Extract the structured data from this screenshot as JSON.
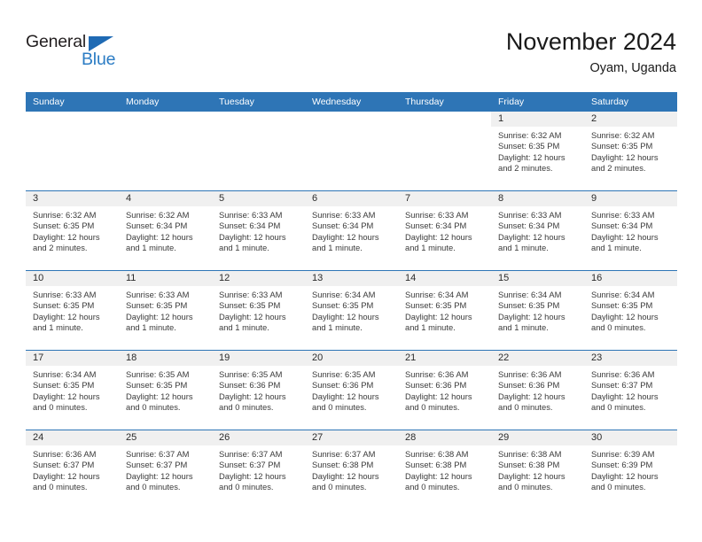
{
  "brand": {
    "name_part1": "General",
    "name_part2": "Blue",
    "triangle_color": "#1f6ab4",
    "blue_color": "#2b7cc4"
  },
  "header": {
    "title": "November 2024",
    "subtitle": "Oyam, Uganda"
  },
  "theme": {
    "header_blue": "#2e75b6",
    "daynum_band": "#f0f0f0",
    "text": "#3a3a3a"
  },
  "weekdays": [
    "Sunday",
    "Monday",
    "Tuesday",
    "Wednesday",
    "Thursday",
    "Friday",
    "Saturday"
  ],
  "weeks": [
    [
      {
        "day": "",
        "state": "blank",
        "sunrise": "",
        "sunset": "",
        "daylight1": "",
        "daylight2": ""
      },
      {
        "day": "",
        "state": "blank",
        "sunrise": "",
        "sunset": "",
        "daylight1": "",
        "daylight2": ""
      },
      {
        "day": "",
        "state": "blank",
        "sunrise": "",
        "sunset": "",
        "daylight1": "",
        "daylight2": ""
      },
      {
        "day": "",
        "state": "blank",
        "sunrise": "",
        "sunset": "",
        "daylight1": "",
        "daylight2": ""
      },
      {
        "day": "",
        "state": "blank",
        "sunrise": "",
        "sunset": "",
        "daylight1": "",
        "daylight2": ""
      },
      {
        "day": "1",
        "state": "filled",
        "sunrise": "Sunrise: 6:32 AM",
        "sunset": "Sunset: 6:35 PM",
        "daylight1": "Daylight: 12 hours",
        "daylight2": "and 2 minutes."
      },
      {
        "day": "2",
        "state": "filled",
        "sunrise": "Sunrise: 6:32 AM",
        "sunset": "Sunset: 6:35 PM",
        "daylight1": "Daylight: 12 hours",
        "daylight2": "and 2 minutes."
      }
    ],
    [
      {
        "day": "3",
        "state": "filled",
        "sunrise": "Sunrise: 6:32 AM",
        "sunset": "Sunset: 6:35 PM",
        "daylight1": "Daylight: 12 hours",
        "daylight2": "and 2 minutes."
      },
      {
        "day": "4",
        "state": "filled",
        "sunrise": "Sunrise: 6:32 AM",
        "sunset": "Sunset: 6:34 PM",
        "daylight1": "Daylight: 12 hours",
        "daylight2": "and 1 minute."
      },
      {
        "day": "5",
        "state": "filled",
        "sunrise": "Sunrise: 6:33 AM",
        "sunset": "Sunset: 6:34 PM",
        "daylight1": "Daylight: 12 hours",
        "daylight2": "and 1 minute."
      },
      {
        "day": "6",
        "state": "filled",
        "sunrise": "Sunrise: 6:33 AM",
        "sunset": "Sunset: 6:34 PM",
        "daylight1": "Daylight: 12 hours",
        "daylight2": "and 1 minute."
      },
      {
        "day": "7",
        "state": "filled",
        "sunrise": "Sunrise: 6:33 AM",
        "sunset": "Sunset: 6:34 PM",
        "daylight1": "Daylight: 12 hours",
        "daylight2": "and 1 minute."
      },
      {
        "day": "8",
        "state": "filled",
        "sunrise": "Sunrise: 6:33 AM",
        "sunset": "Sunset: 6:34 PM",
        "daylight1": "Daylight: 12 hours",
        "daylight2": "and 1 minute."
      },
      {
        "day": "9",
        "state": "filled",
        "sunrise": "Sunrise: 6:33 AM",
        "sunset": "Sunset: 6:34 PM",
        "daylight1": "Daylight: 12 hours",
        "daylight2": "and 1 minute."
      }
    ],
    [
      {
        "day": "10",
        "state": "filled",
        "sunrise": "Sunrise: 6:33 AM",
        "sunset": "Sunset: 6:35 PM",
        "daylight1": "Daylight: 12 hours",
        "daylight2": "and 1 minute."
      },
      {
        "day": "11",
        "state": "filled",
        "sunrise": "Sunrise: 6:33 AM",
        "sunset": "Sunset: 6:35 PM",
        "daylight1": "Daylight: 12 hours",
        "daylight2": "and 1 minute."
      },
      {
        "day": "12",
        "state": "filled",
        "sunrise": "Sunrise: 6:33 AM",
        "sunset": "Sunset: 6:35 PM",
        "daylight1": "Daylight: 12 hours",
        "daylight2": "and 1 minute."
      },
      {
        "day": "13",
        "state": "filled",
        "sunrise": "Sunrise: 6:34 AM",
        "sunset": "Sunset: 6:35 PM",
        "daylight1": "Daylight: 12 hours",
        "daylight2": "and 1 minute."
      },
      {
        "day": "14",
        "state": "filled",
        "sunrise": "Sunrise: 6:34 AM",
        "sunset": "Sunset: 6:35 PM",
        "daylight1": "Daylight: 12 hours",
        "daylight2": "and 1 minute."
      },
      {
        "day": "15",
        "state": "filled",
        "sunrise": "Sunrise: 6:34 AM",
        "sunset": "Sunset: 6:35 PM",
        "daylight1": "Daylight: 12 hours",
        "daylight2": "and 1 minute."
      },
      {
        "day": "16",
        "state": "filled",
        "sunrise": "Sunrise: 6:34 AM",
        "sunset": "Sunset: 6:35 PM",
        "daylight1": "Daylight: 12 hours",
        "daylight2": "and 0 minutes."
      }
    ],
    [
      {
        "day": "17",
        "state": "filled",
        "sunrise": "Sunrise: 6:34 AM",
        "sunset": "Sunset: 6:35 PM",
        "daylight1": "Daylight: 12 hours",
        "daylight2": "and 0 minutes."
      },
      {
        "day": "18",
        "state": "filled",
        "sunrise": "Sunrise: 6:35 AM",
        "sunset": "Sunset: 6:35 PM",
        "daylight1": "Daylight: 12 hours",
        "daylight2": "and 0 minutes."
      },
      {
        "day": "19",
        "state": "filled",
        "sunrise": "Sunrise: 6:35 AM",
        "sunset": "Sunset: 6:36 PM",
        "daylight1": "Daylight: 12 hours",
        "daylight2": "and 0 minutes."
      },
      {
        "day": "20",
        "state": "filled",
        "sunrise": "Sunrise: 6:35 AM",
        "sunset": "Sunset: 6:36 PM",
        "daylight1": "Daylight: 12 hours",
        "daylight2": "and 0 minutes."
      },
      {
        "day": "21",
        "state": "filled",
        "sunrise": "Sunrise: 6:36 AM",
        "sunset": "Sunset: 6:36 PM",
        "daylight1": "Daylight: 12 hours",
        "daylight2": "and 0 minutes."
      },
      {
        "day": "22",
        "state": "filled",
        "sunrise": "Sunrise: 6:36 AM",
        "sunset": "Sunset: 6:36 PM",
        "daylight1": "Daylight: 12 hours",
        "daylight2": "and 0 minutes."
      },
      {
        "day": "23",
        "state": "filled",
        "sunrise": "Sunrise: 6:36 AM",
        "sunset": "Sunset: 6:37 PM",
        "daylight1": "Daylight: 12 hours",
        "daylight2": "and 0 minutes."
      }
    ],
    [
      {
        "day": "24",
        "state": "filled",
        "sunrise": "Sunrise: 6:36 AM",
        "sunset": "Sunset: 6:37 PM",
        "daylight1": "Daylight: 12 hours",
        "daylight2": "and 0 minutes."
      },
      {
        "day": "25",
        "state": "filled",
        "sunrise": "Sunrise: 6:37 AM",
        "sunset": "Sunset: 6:37 PM",
        "daylight1": "Daylight: 12 hours",
        "daylight2": "and 0 minutes."
      },
      {
        "day": "26",
        "state": "filled",
        "sunrise": "Sunrise: 6:37 AM",
        "sunset": "Sunset: 6:37 PM",
        "daylight1": "Daylight: 12 hours",
        "daylight2": "and 0 minutes."
      },
      {
        "day": "27",
        "state": "filled",
        "sunrise": "Sunrise: 6:37 AM",
        "sunset": "Sunset: 6:38 PM",
        "daylight1": "Daylight: 12 hours",
        "daylight2": "and 0 minutes."
      },
      {
        "day": "28",
        "state": "filled",
        "sunrise": "Sunrise: 6:38 AM",
        "sunset": "Sunset: 6:38 PM",
        "daylight1": "Daylight: 12 hours",
        "daylight2": "and 0 minutes."
      },
      {
        "day": "29",
        "state": "filled",
        "sunrise": "Sunrise: 6:38 AM",
        "sunset": "Sunset: 6:38 PM",
        "daylight1": "Daylight: 12 hours",
        "daylight2": "and 0 minutes."
      },
      {
        "day": "30",
        "state": "filled",
        "sunrise": "Sunrise: 6:39 AM",
        "sunset": "Sunset: 6:39 PM",
        "daylight1": "Daylight: 12 hours",
        "daylight2": "and 0 minutes."
      }
    ]
  ]
}
